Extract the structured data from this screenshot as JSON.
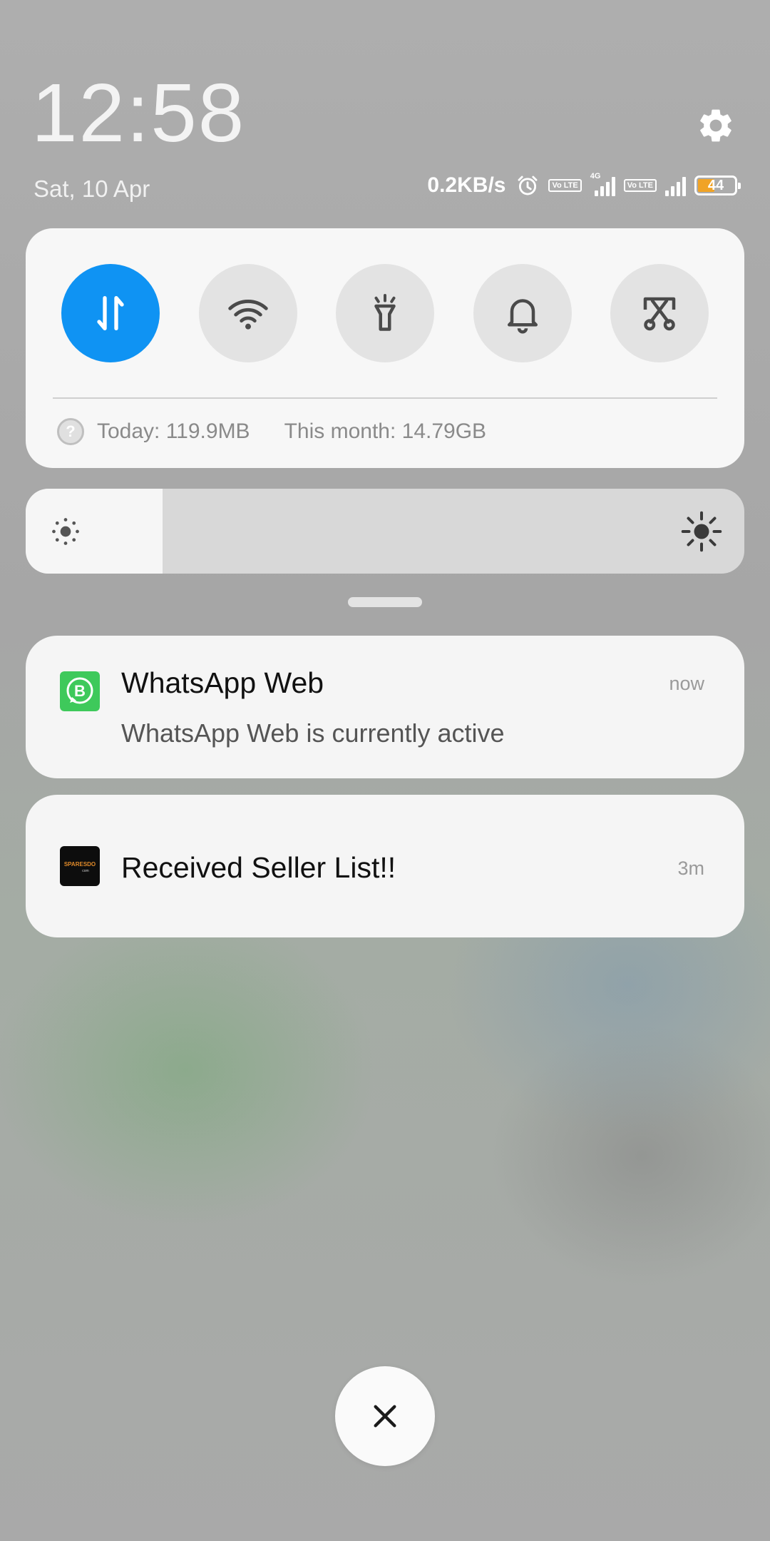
{
  "lockscreen": {
    "time": "12:58",
    "date": "Sat, 10 Apr"
  },
  "status_bar": {
    "net_speed": "0.2KB/s",
    "volte_1": "Vo LTE",
    "volte_2": "Vo LTE",
    "network_type": "4G",
    "battery_level": "44",
    "battery_color": "#f0a326",
    "icons": [
      "alarm-icon",
      "volte-icon",
      "signal-4g-icon",
      "volte-icon",
      "signal-icon",
      "battery-icon"
    ]
  },
  "quick_settings": {
    "toggles": [
      {
        "name": "mobile-data",
        "icon": "data-arrows-icon",
        "active": true
      },
      {
        "name": "wifi",
        "icon": "wifi-icon",
        "active": false
      },
      {
        "name": "flashlight",
        "icon": "flashlight-icon",
        "active": false
      },
      {
        "name": "sound",
        "icon": "bell-icon",
        "active": false
      },
      {
        "name": "screenshot",
        "icon": "scissors-icon",
        "active": false
      }
    ],
    "active_color": "#0f93f3",
    "help_glyph": "?",
    "usage_today": "Today: 119.9MB",
    "usage_month": "This month: 14.79GB"
  },
  "brightness": {
    "level": 0.19
  },
  "notifications": [
    {
      "app_icon": "whatsapp-business-icon",
      "icon_letter": "B",
      "title": "WhatsApp Web",
      "text": "WhatsApp Web is currently active",
      "time": "now"
    },
    {
      "app_icon": "sparesdo-logo-icon",
      "icon_text": "SPARESDO",
      "icon_subtext": "com",
      "title": "Received Seller List!!",
      "time": "3m"
    }
  ],
  "close_button": {
    "icon": "close-icon",
    "glyph": "✕"
  }
}
